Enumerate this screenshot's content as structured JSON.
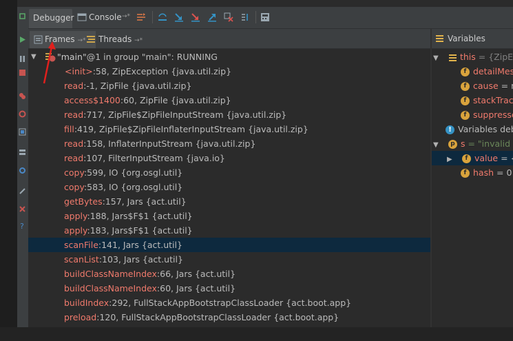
{
  "toolbar": {
    "debugger_tab": "Debugger",
    "console_tab": "Console",
    "console_pin": "→*"
  },
  "panels": {
    "frames_tab": "Frames",
    "frames_pin": "→*",
    "threads_tab": "Threads",
    "threads_pin": "→*",
    "variables_title": "Variables"
  },
  "thread": {
    "name": "\"main\"",
    "rest": "@1 in group \"main\": RUNNING"
  },
  "frames": [
    {
      "method": "<init>",
      "location": ":58, ZipException {java.util.zip}"
    },
    {
      "method": "read",
      "location": ":-1, ZipFile {java.util.zip}"
    },
    {
      "method": "access$1400",
      "location": ":60, ZipFile {java.util.zip}"
    },
    {
      "method": "read",
      "location": ":717, ZipFile$ZipFileInputStream {java.util.zip}"
    },
    {
      "method": "fill",
      "location": ":419, ZipFile$ZipFileInflaterInputStream {java.util.zip}"
    },
    {
      "method": "read",
      "location": ":158, InflaterInputStream {java.util.zip}"
    },
    {
      "method": "read",
      "location": ":107, FilterInputStream {java.io}"
    },
    {
      "method": "copy",
      "location": ":599, IO {org.osgl.util}"
    },
    {
      "method": "copy",
      "location": ":583, IO {org.osgl.util}"
    },
    {
      "method": "getBytes",
      "location": ":157, Jars {act.util}"
    },
    {
      "method": "apply",
      "location": ":188, Jars$F$1 {act.util}"
    },
    {
      "method": "apply",
      "location": ":183, Jars$F$1 {act.util}"
    },
    {
      "method": "scanFile",
      "location": ":141, Jars {act.util}"
    },
    {
      "method": "scanList",
      "location": ":103, Jars {act.util}"
    },
    {
      "method": "buildClassNameIndex",
      "location": ":66, Jars {act.util}"
    },
    {
      "method": "buildClassNameIndex",
      "location": ":60, Jars {act.util}"
    },
    {
      "method": "buildIndex",
      "location": ":292, FullStackAppBootstrapClassLoader {act.boot.app}"
    },
    {
      "method": "preload",
      "location": ":120, FullStackAppBootstrapClassLoader {act.boot.app}"
    }
  ],
  "variables": {
    "this_name": "this",
    "this_value": " = {ZipExc",
    "fields": [
      {
        "name": "detailMes",
        "value": ""
      },
      {
        "name": "cause",
        "value": " = n"
      },
      {
        "name": "stackTrace",
        "value": ""
      },
      {
        "name": "suppresse",
        "value": ""
      }
    ],
    "info": "Variables deb",
    "s_name": "s",
    "s_value": " = \"invalid LO",
    "value_name": "value",
    "value_value": " = {c",
    "hash_name": "hash",
    "hash_value": " = 0"
  },
  "colors": {
    "selected_row": "#0d293e",
    "method": "#f07a6c",
    "badge": "#d9a33c",
    "arrow": "#e0201d"
  }
}
